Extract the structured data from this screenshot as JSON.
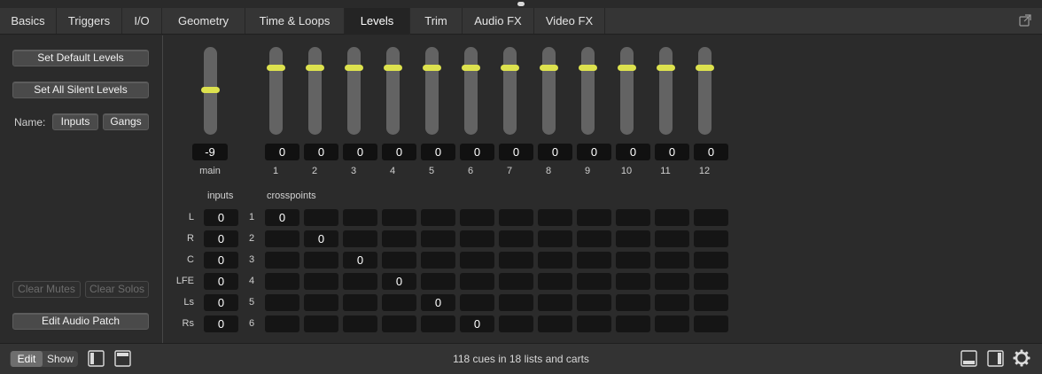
{
  "tabs": [
    {
      "label": "Basics",
      "active": false
    },
    {
      "label": "Triggers",
      "active": false
    },
    {
      "label": "I/O",
      "active": false
    },
    {
      "label": "Geometry",
      "active": false
    },
    {
      "label": "Time & Loops",
      "active": false
    },
    {
      "label": "Levels",
      "active": true
    },
    {
      "label": "Trim",
      "active": false
    },
    {
      "label": "Audio FX",
      "active": false
    },
    {
      "label": "Video FX",
      "active": false
    }
  ],
  "left": {
    "set_default_levels": "Set Default Levels",
    "set_all_silent_levels": "Set All Silent Levels",
    "name_label": "Name:",
    "inputs_button": "Inputs",
    "gangs_button": "Gangs",
    "clear_mutes": "Clear Mutes",
    "clear_solos": "Clear Solos",
    "edit_audio_patch": "Edit Audio Patch"
  },
  "faders": {
    "main": {
      "label": "main",
      "value": "-9",
      "level": 0.51
    },
    "channels": [
      {
        "label": "1",
        "value": "0",
        "level": 0.76
      },
      {
        "label": "2",
        "value": "0",
        "level": 0.76
      },
      {
        "label": "3",
        "value": "0",
        "level": 0.76
      },
      {
        "label": "4",
        "value": "0",
        "level": 0.76
      },
      {
        "label": "5",
        "value": "0",
        "level": 0.76
      },
      {
        "label": "6",
        "value": "0",
        "level": 0.76
      },
      {
        "label": "7",
        "value": "0",
        "level": 0.76
      },
      {
        "label": "8",
        "value": "0",
        "level": 0.76
      },
      {
        "label": "9",
        "value": "0",
        "level": 0.76
      },
      {
        "label": "10",
        "value": "0",
        "level": 0.76
      },
      {
        "label": "11",
        "value": "0",
        "level": 0.76
      },
      {
        "label": "12",
        "value": "0",
        "level": 0.76
      }
    ]
  },
  "matrix": {
    "inputs_label": "inputs",
    "crosspoints_label": "crosspoints",
    "rows": [
      {
        "name": "L",
        "input": "0",
        "num": "1",
        "cells": [
          "0",
          "",
          "",
          "",
          "",
          "",
          "",
          "",
          "",
          "",
          "",
          ""
        ]
      },
      {
        "name": "R",
        "input": "0",
        "num": "2",
        "cells": [
          "",
          "0",
          "",
          "",
          "",
          "",
          "",
          "",
          "",
          "",
          "",
          ""
        ]
      },
      {
        "name": "C",
        "input": "0",
        "num": "3",
        "cells": [
          "",
          "",
          "0",
          "",
          "",
          "",
          "",
          "",
          "",
          "",
          "",
          ""
        ]
      },
      {
        "name": "LFE",
        "input": "0",
        "num": "4",
        "cells": [
          "",
          "",
          "",
          "0",
          "",
          "",
          "",
          "",
          "",
          "",
          "",
          ""
        ]
      },
      {
        "name": "Ls",
        "input": "0",
        "num": "5",
        "cells": [
          "",
          "",
          "",
          "",
          "0",
          "",
          "",
          "",
          "",
          "",
          "",
          ""
        ]
      },
      {
        "name": "Rs",
        "input": "0",
        "num": "6",
        "cells": [
          "",
          "",
          "",
          "",
          "",
          "0",
          "",
          "",
          "",
          "",
          "",
          ""
        ]
      }
    ]
  },
  "bottom": {
    "edit_label": "Edit",
    "show_label": "Show",
    "status": "118 cues in 18 lists and carts"
  },
  "colors": {
    "fader_knob": "#dde24e",
    "active_tab": "#242424"
  }
}
